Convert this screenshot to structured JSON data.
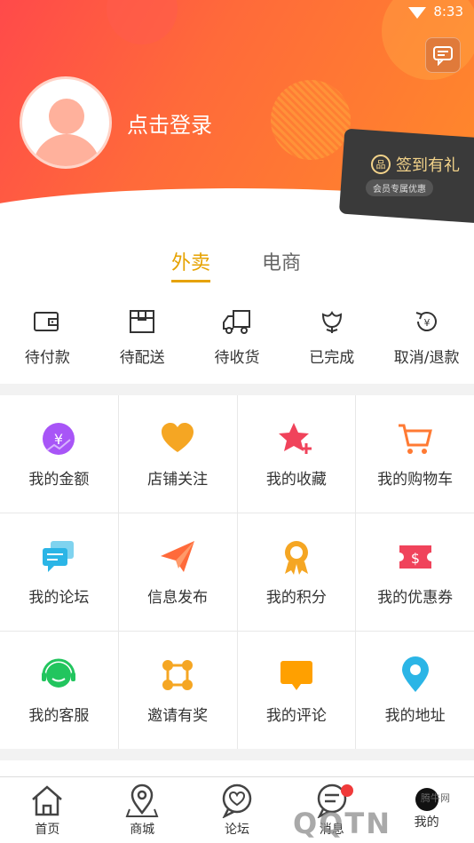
{
  "status": {
    "time": "8:33"
  },
  "header": {
    "login_text": "点击登录",
    "signin_title": "签到有礼",
    "signin_sub": "会员专属优惠",
    "gift_glyph": "品"
  },
  "tabs": [
    {
      "label": "外卖",
      "active": true
    },
    {
      "label": "电商",
      "active": false
    }
  ],
  "orders": [
    {
      "label": "待付款",
      "icon": "wallet-icon"
    },
    {
      "label": "待配送",
      "icon": "box-icon"
    },
    {
      "label": "待收货",
      "icon": "truck-icon"
    },
    {
      "label": "已完成",
      "icon": "flower-icon"
    },
    {
      "label": "取消/退款",
      "icon": "refund-icon"
    }
  ],
  "grid": [
    {
      "label": "我的金额",
      "icon": "money-icon",
      "color": "#a855f7"
    },
    {
      "label": "店铺关注",
      "icon": "heart-icon",
      "color": "#f5a623"
    },
    {
      "label": "我的收藏",
      "icon": "star-icon",
      "color": "#f0435b"
    },
    {
      "label": "我的购物车",
      "icon": "cart-icon",
      "color": "#ff7a33"
    },
    {
      "label": "我的论坛",
      "icon": "forum-icon",
      "color": "#2bb5e6"
    },
    {
      "label": "信息发布",
      "icon": "send-icon",
      "color": "#ff6a3a"
    },
    {
      "label": "我的积分",
      "icon": "medal-icon",
      "color": "#f5a623"
    },
    {
      "label": "我的优惠券",
      "icon": "coupon-icon",
      "color": "#f0435b"
    },
    {
      "label": "我的客服",
      "icon": "headset-icon",
      "color": "#22c55e"
    },
    {
      "label": "邀请有奖",
      "icon": "invite-icon",
      "color": "#f5a623"
    },
    {
      "label": "我的评论",
      "icon": "comment-icon",
      "color": "#ffa000"
    },
    {
      "label": "我的地址",
      "icon": "location-icon",
      "color": "#2bb5e6"
    }
  ],
  "bottom_nav": [
    {
      "label": "首页",
      "icon": "home-icon"
    },
    {
      "label": "商城",
      "icon": "map-icon"
    },
    {
      "label": "论坛",
      "icon": "forum-heart-icon"
    },
    {
      "label": "消息",
      "icon": "message-icon"
    },
    {
      "label": "我的",
      "icon": "profile-icon"
    }
  ],
  "watermark": {
    "text": "QQTN",
    "small": "腾牛网"
  }
}
